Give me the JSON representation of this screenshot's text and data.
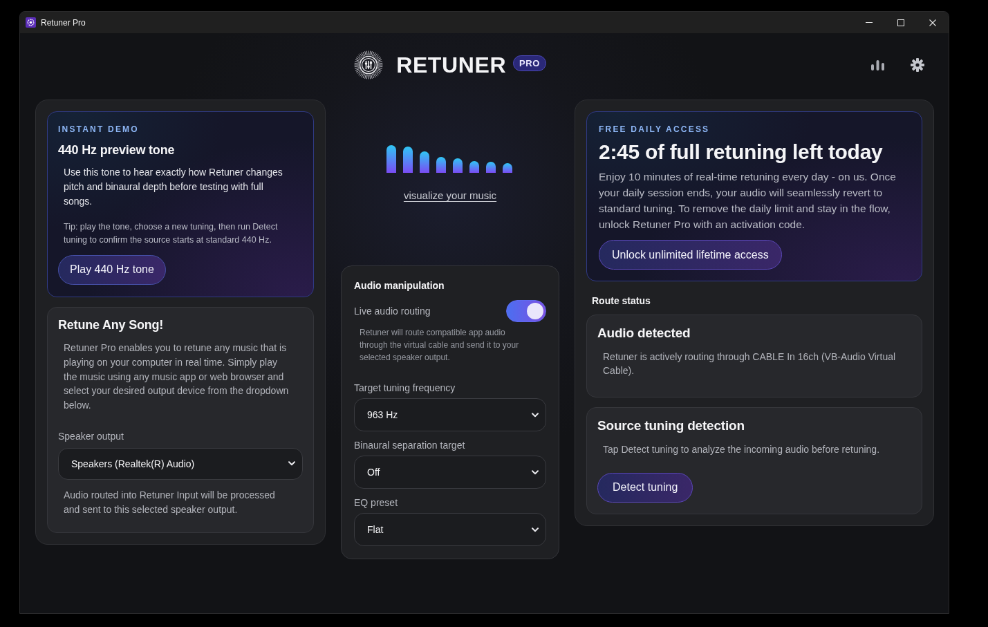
{
  "window": {
    "title": "Retuner Pro"
  },
  "header": {
    "brand": "RETUNER",
    "badge": "PRO"
  },
  "demo_card": {
    "eyebrow": "INSTANT DEMO",
    "title": "440 Hz preview tone",
    "body": "Use this tone to hear exactly how Retuner changes pitch and binaural depth before testing with full songs.",
    "tip": "Tip: play the tone, choose a new tuning, then run Detect tuning to confirm the source starts at standard 440 Hz.",
    "button": "Play 440 Hz tone"
  },
  "intro_card": {
    "title": "Retune Any Song!",
    "body": "Retuner Pro enables you to retune any music that is playing on your computer in real time. Simply play the music using any music app or web browser and select your desired output device from the dropdown below.",
    "output": {
      "label": "Speaker output",
      "value": "Speakers (Realtek(R) Audio)"
    },
    "note": "Audio routed into Retuner Input will be processed and sent to this selected speaker output."
  },
  "visualizer": {
    "link": "visualize your music"
  },
  "audio_panel": {
    "title": "Audio manipulation",
    "toggle": {
      "label": "Live audio routing",
      "on": true,
      "hint": "Retuner will route compatible app audio through the virtual cable and send it to your selected speaker output."
    },
    "selects": [
      {
        "label": "Target tuning frequency",
        "value": "963 Hz"
      },
      {
        "label": "Binaural separation target",
        "value": "Off"
      },
      {
        "label": "EQ preset",
        "value": "Flat"
      }
    ]
  },
  "access_card": {
    "eyebrow": "FREE DAILY ACCESS",
    "title": "2:45 of full retuning left today",
    "body": "Enjoy 10 minutes of real-time retuning every day - on us. Once your daily session ends, your audio will seamlessly revert to standard tuning. To remove the daily limit and stay in the flow, unlock Retuner Pro with an activation code.",
    "button": "Unlock unlimited lifetime access"
  },
  "route_status": {
    "heading": "Route status",
    "cards": [
      {
        "title": "Audio detected",
        "body": "Retuner is actively routing through CABLE In 16ch (VB-Audio Virtual Cable)."
      },
      {
        "title": "Source tuning detection",
        "body": "Tap Detect tuning to analyze the incoming audio before retuning.",
        "button": "Detect tuning"
      }
    ]
  }
}
